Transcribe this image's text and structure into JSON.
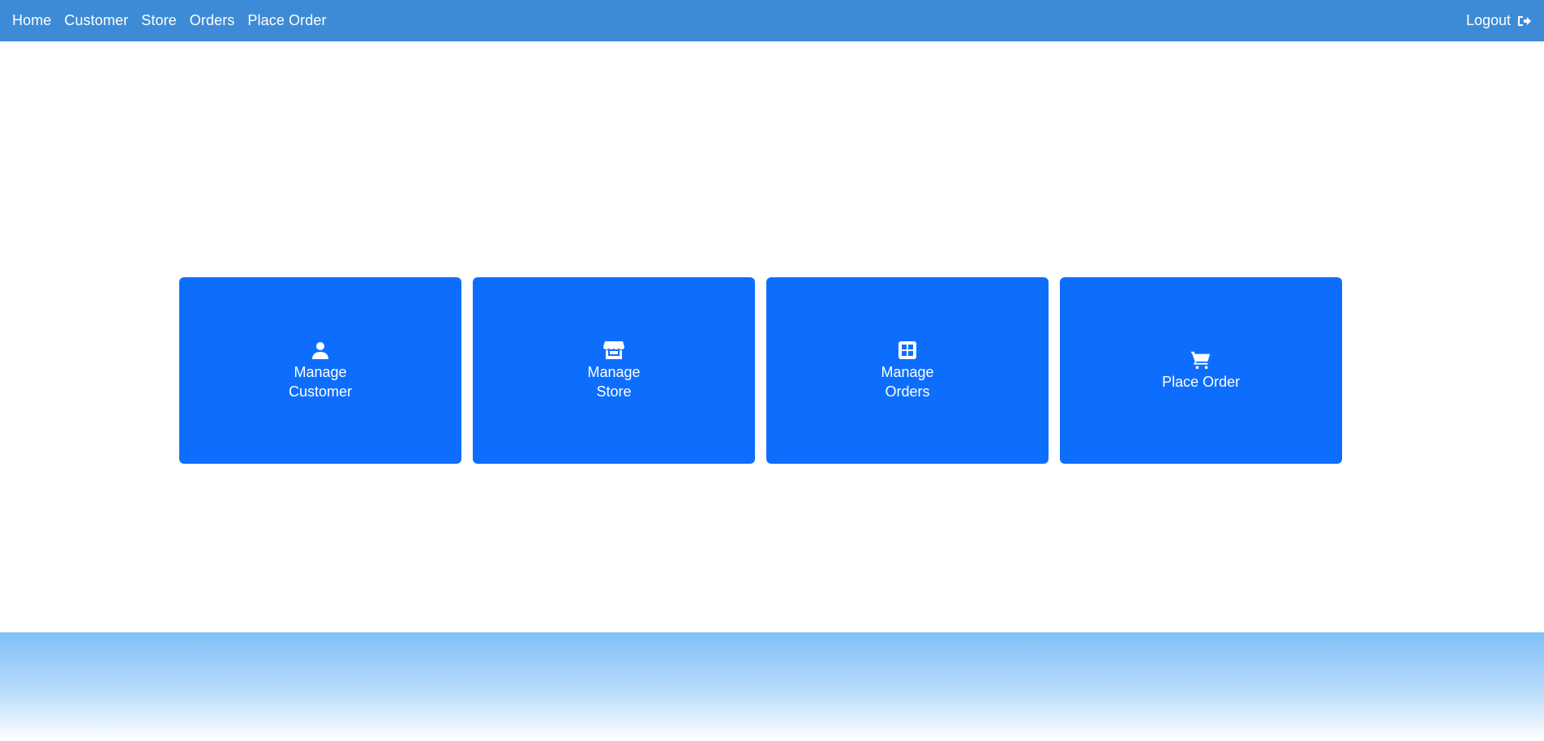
{
  "navbar": {
    "links": [
      {
        "label": "Home"
      },
      {
        "label": "Customer"
      },
      {
        "label": "Store"
      },
      {
        "label": "Orders"
      },
      {
        "label": "Place Order"
      }
    ],
    "logout_label": "Logout",
    "logout_icon": "sign-out-icon"
  },
  "cards": [
    {
      "icon": "user-icon",
      "line1": "Manage",
      "line2": "Customer"
    },
    {
      "icon": "store-icon",
      "line1": "Manage",
      "line2": "Store"
    },
    {
      "icon": "grid-icon",
      "line1": "Manage",
      "line2": "Orders"
    },
    {
      "icon": "cart-icon",
      "line1": "Place Order",
      "line2": ""
    }
  ],
  "colors": {
    "navbar_bg": "#3d8bd6",
    "card_bg": "#0d6efd",
    "footer_gradient_top": "#7fc0f8"
  }
}
